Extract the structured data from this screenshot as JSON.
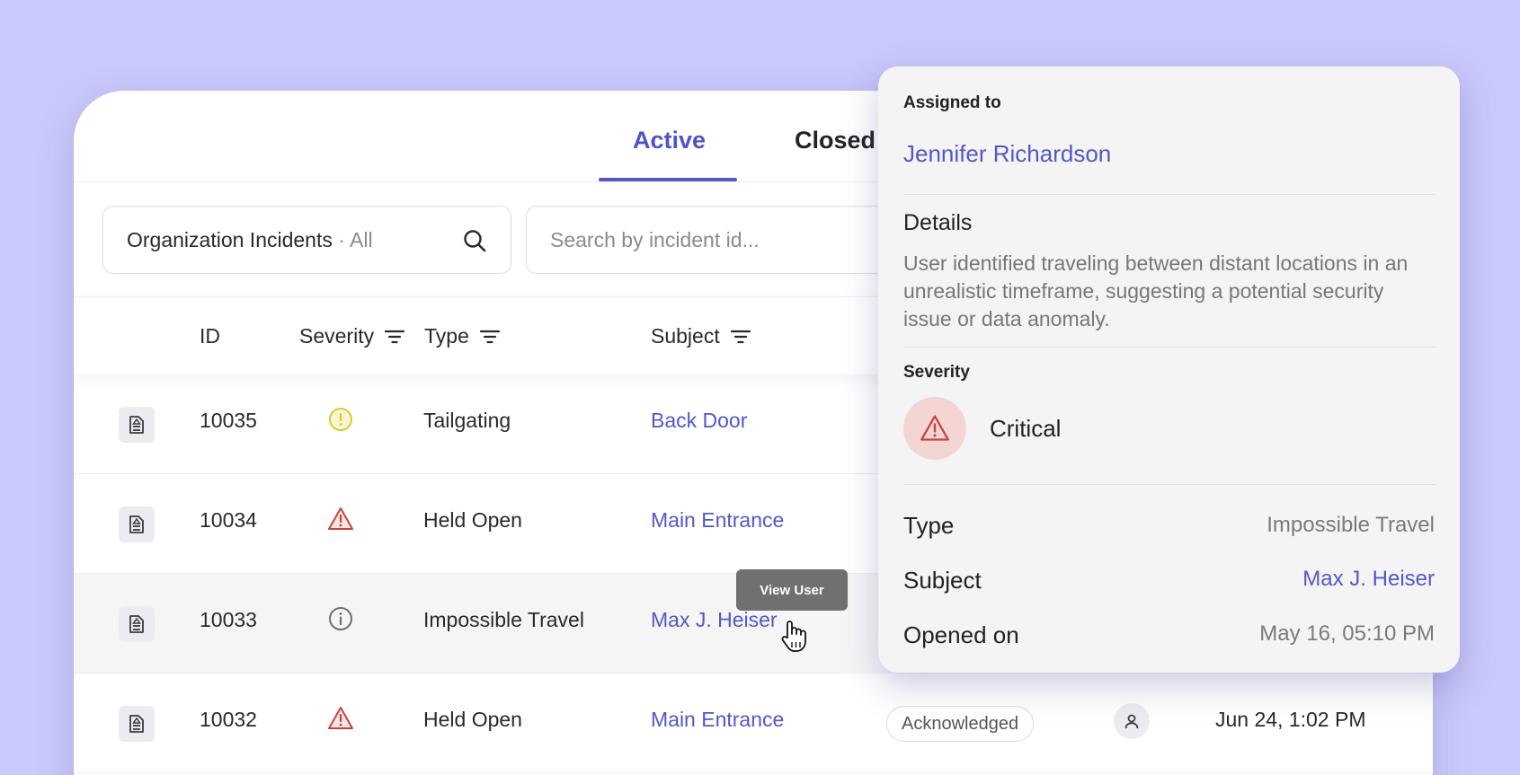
{
  "tabs": {
    "active": "Active",
    "closed": "Closed"
  },
  "filter": {
    "label": "Organization Incidents",
    "separator": "·",
    "value": "All"
  },
  "search": {
    "placeholder": "Search by incident id..."
  },
  "columns": {
    "id": "ID",
    "severity": "Severity",
    "type": "Type",
    "subject": "Subject"
  },
  "rows": [
    {
      "id": "10035",
      "severity": "warning",
      "type": "Tailgating",
      "subject": "Back Door"
    },
    {
      "id": "10034",
      "severity": "critical",
      "type": "Held Open",
      "subject": "Main Entrance"
    },
    {
      "id": "10033",
      "severity": "info",
      "type": "Impossible Travel",
      "subject": "Max J. Heiser"
    },
    {
      "id": "10032",
      "severity": "critical",
      "type": "Held Open",
      "subject": "Main Entrance",
      "status": "Acknowledged",
      "date": "Jun 24, 1:02 PM"
    }
  ],
  "tooltip": {
    "text": "View User"
  },
  "panel": {
    "assigned_label": "Assigned to",
    "assigned_name": "Jennifer Richardson",
    "details_title": "Details",
    "details_text": "User identified traveling between distant locations in an unrealistic timeframe, suggesting a potential security issue or data anomaly.",
    "severity_label": "Severity",
    "severity_value": "Critical",
    "type_label": "Type",
    "type_value": "Impossible Travel",
    "subject_label": "Subject",
    "subject_value": "Max J. Heiser",
    "opened_label": "Opened on",
    "opened_value": "May 16, 05:10 PM"
  },
  "colors": {
    "accent": "#5357c8",
    "background": "#c9c9fb",
    "critical": "#c4463a",
    "warning": "#d8c93a",
    "info": "#6e6e74"
  },
  "icons": {
    "doc": "document-icon",
    "search": "search-icon",
    "filter": "filter-icon",
    "warning": "warning-circle-icon",
    "critical": "alert-triangle-icon",
    "info": "info-circle-icon",
    "user": "user-icon",
    "cursor": "hand-cursor-icon"
  }
}
